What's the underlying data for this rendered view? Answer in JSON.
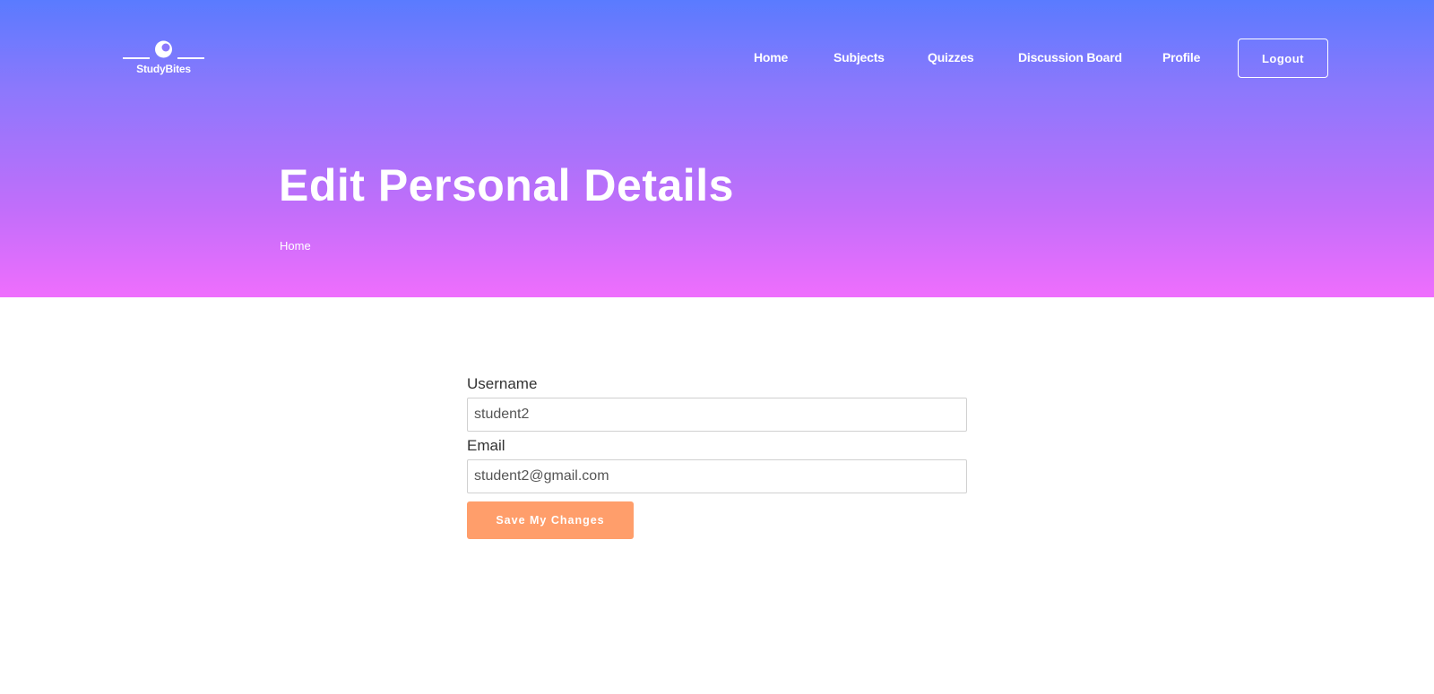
{
  "brand": {
    "name": "StudyBites",
    "accent": "#ffffff"
  },
  "nav": {
    "items": [
      {
        "label": "Home"
      },
      {
        "label": "Subjects"
      },
      {
        "label": "Quizzes"
      },
      {
        "label": "Discussion Board"
      },
      {
        "label": "Profile"
      }
    ],
    "logout_label": "Logout"
  },
  "hero": {
    "title": "Edit Personal Details",
    "breadcrumb": "Home",
    "gradient": [
      "#5a7bff",
      "#ef6efd"
    ]
  },
  "form": {
    "username_label": "Username",
    "username_value": "student2",
    "email_label": "Email",
    "email_value": "student2@gmail.com",
    "submit_label": "Save My Changes",
    "submit_color": "#ff9e6b"
  }
}
